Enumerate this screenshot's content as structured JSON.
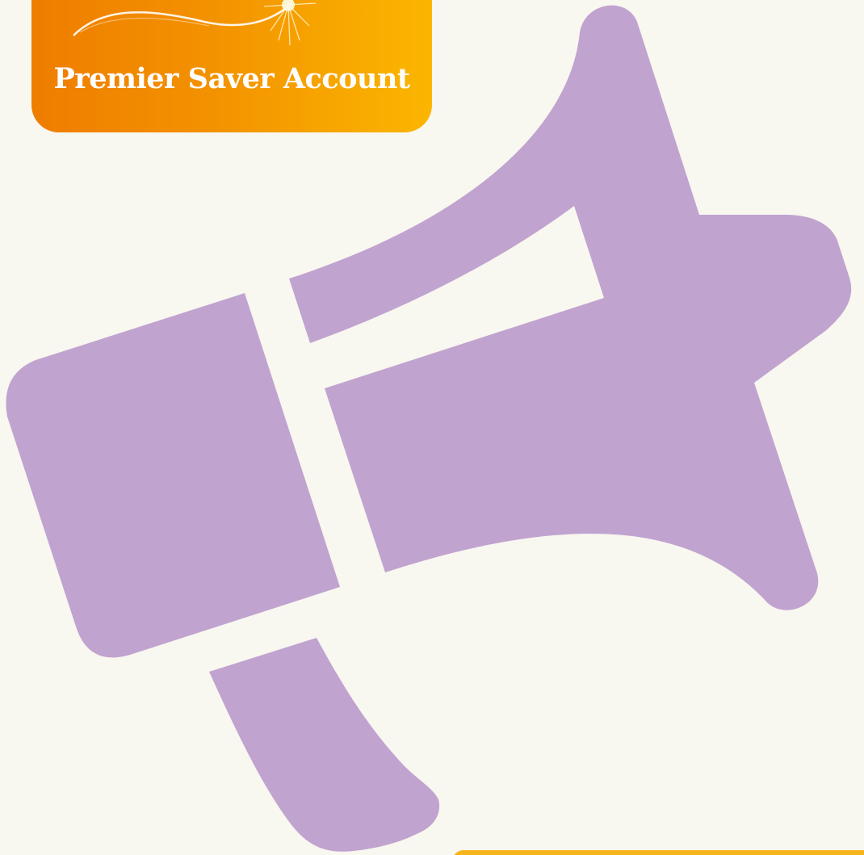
{
  "badge": {
    "label": "Premier Saver Account"
  },
  "colors": {
    "background": "#f8f7f0",
    "megaphone": "#c1a3cf",
    "badge_start": "#ef7d00",
    "badge_end": "#fbb600",
    "corner_accent": "#f6b51c",
    "badge_text": "#ffffff"
  },
  "icons": {
    "main": "megaphone-icon",
    "badge_decoration": "sparkle-swoosh-icon"
  }
}
